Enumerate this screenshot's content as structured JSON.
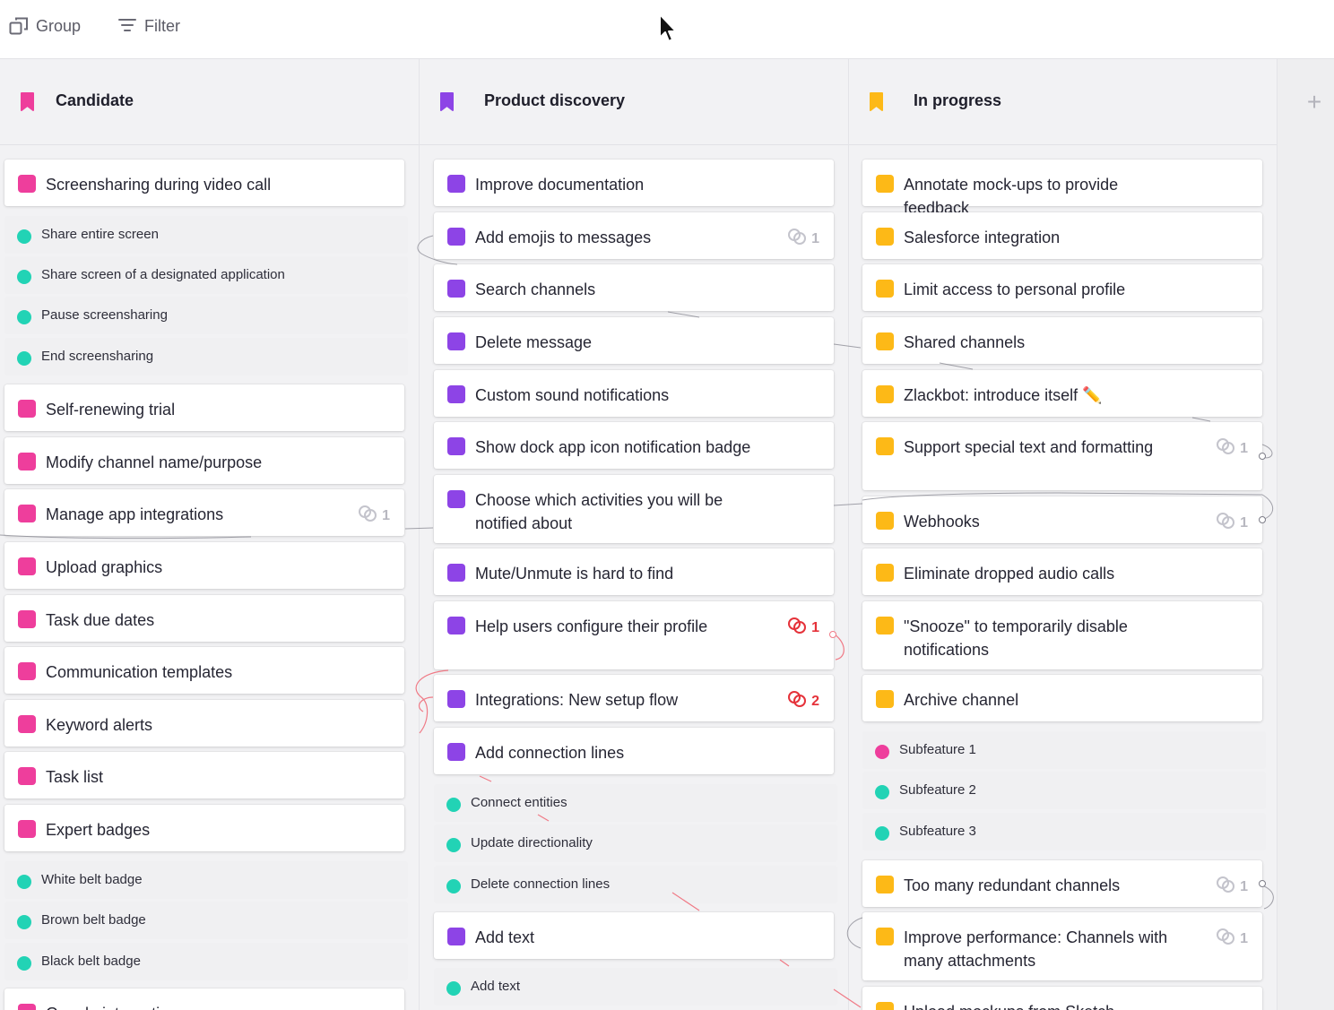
{
  "toolbar": {
    "group_label": "Group",
    "filter_label": "Filter"
  },
  "colors": {
    "pink": "#ee3e9c",
    "purple": "#8d44e6",
    "orange": "#fdb917",
    "teal": "#22d3b5",
    "red": "#e5323a"
  },
  "columns": [
    {
      "title": "Candidate",
      "color": "#ee3e9c",
      "items": [
        {
          "kind": "card",
          "label": "Screensharing during video call"
        },
        {
          "kind": "sub",
          "label": "Share entire screen"
        },
        {
          "kind": "sub",
          "label": "Share screen of a designated application"
        },
        {
          "kind": "sub",
          "label": "Pause screensharing"
        },
        {
          "kind": "sub",
          "label": "End screensharing"
        },
        {
          "kind": "card",
          "label": "Self-renewing trial"
        },
        {
          "kind": "card",
          "label": "Modify channel name/purpose"
        },
        {
          "kind": "card",
          "label": "Manage app integrations",
          "links": "1"
        },
        {
          "kind": "card",
          "label": "Upload graphics"
        },
        {
          "kind": "card",
          "label": "Task due dates"
        },
        {
          "kind": "card",
          "label": "Communication templates"
        },
        {
          "kind": "card",
          "label": "Keyword alerts"
        },
        {
          "kind": "card",
          "label": "Task list"
        },
        {
          "kind": "card",
          "label": "Expert badges"
        },
        {
          "kind": "sub",
          "label": "White belt badge"
        },
        {
          "kind": "sub",
          "label": "Brown belt badge"
        },
        {
          "kind": "sub",
          "label": "Black belt badge"
        },
        {
          "kind": "card",
          "label": "Google integration"
        }
      ]
    },
    {
      "title": "Product discovery",
      "color": "#8d44e6",
      "items": [
        {
          "kind": "card",
          "label": "Improve documentation"
        },
        {
          "kind": "card",
          "label": "Add emojis to messages",
          "links": "1"
        },
        {
          "kind": "card",
          "label": "Search channels"
        },
        {
          "kind": "card",
          "label": "Delete message"
        },
        {
          "kind": "card",
          "label": "Custom sound notifications"
        },
        {
          "kind": "card",
          "label": "Show dock app icon notification badge"
        },
        {
          "kind": "card",
          "label": "Choose which activities you will be notified about"
        },
        {
          "kind": "card",
          "label": "Mute/Unmute is hard to find"
        },
        {
          "kind": "card",
          "label": "Help users configure their profile",
          "links": "1",
          "alert": true
        },
        {
          "kind": "card",
          "label": "Integrations: New setup flow",
          "links": "2",
          "alert": true
        },
        {
          "kind": "card",
          "label": "Add connection lines"
        },
        {
          "kind": "sub",
          "label": "Connect entities"
        },
        {
          "kind": "sub",
          "label": "Update directionality"
        },
        {
          "kind": "sub",
          "label": "Delete connection lines"
        },
        {
          "kind": "card",
          "label": "Add text"
        },
        {
          "kind": "sub",
          "label": "Add text"
        }
      ]
    },
    {
      "title": "In progress",
      "color": "#fdb917",
      "items": [
        {
          "kind": "card",
          "label": "Annotate mock-ups to provide feedback"
        },
        {
          "kind": "card",
          "label": "Salesforce integration"
        },
        {
          "kind": "card",
          "label": "Limit access to personal profile"
        },
        {
          "kind": "card",
          "label": "Shared channels"
        },
        {
          "kind": "card",
          "label": "Zlackbot: introduce itself ✏️"
        },
        {
          "kind": "card",
          "label": "Support special text and formatting",
          "links": "1"
        },
        {
          "kind": "card",
          "label": "Webhooks",
          "links": "1"
        },
        {
          "kind": "card",
          "label": "Eliminate dropped audio calls"
        },
        {
          "kind": "card",
          "label": "\"Snooze\" to temporarily disable notifications"
        },
        {
          "kind": "card",
          "label": "Archive channel"
        },
        {
          "kind": "sub",
          "label": "Subfeature 1",
          "dot": "#ee3e9c"
        },
        {
          "kind": "sub",
          "label": "Subfeature 2"
        },
        {
          "kind": "sub",
          "label": "Subfeature 3"
        },
        {
          "kind": "card",
          "label": "Too many redundant channels",
          "links": "1"
        },
        {
          "kind": "card",
          "label": "Improve performance: Channels with many attachments",
          "links": "1"
        },
        {
          "kind": "card",
          "label": "Upload mockups from Sketch"
        }
      ]
    }
  ]
}
